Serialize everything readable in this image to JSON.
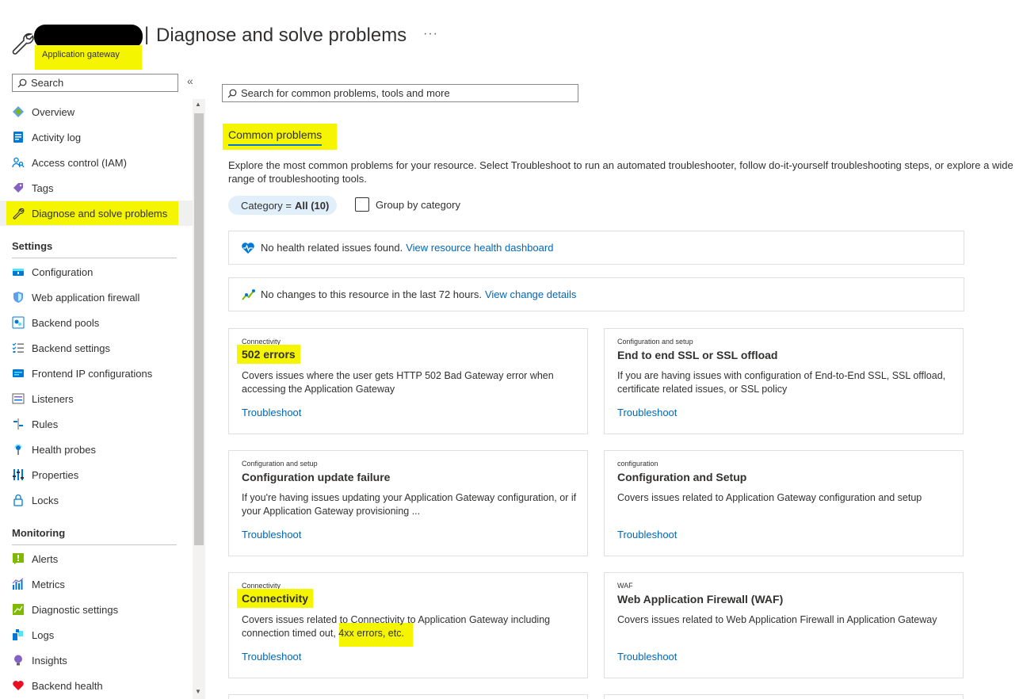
{
  "header": {
    "separator": "|",
    "title": "Diagnose and solve problems",
    "more": "···",
    "subtitle": "Application gateway"
  },
  "sidebar": {
    "search_placeholder": "Search",
    "collapse": "«",
    "items_top": [
      {
        "label": "Overview",
        "icon": "overview-icon"
      },
      {
        "label": "Activity log",
        "icon": "activity-log-icon"
      },
      {
        "label": "Access control (IAM)",
        "icon": "iam-icon"
      },
      {
        "label": "Tags",
        "icon": "tag-icon"
      },
      {
        "label": "Diagnose and solve problems",
        "icon": "wrench-icon",
        "active": true
      }
    ],
    "section_settings": "Settings",
    "items_settings": [
      {
        "label": "Configuration",
        "icon": "configuration-icon"
      },
      {
        "label": "Web application firewall",
        "icon": "shield-icon"
      },
      {
        "label": "Backend pools",
        "icon": "backend-pools-icon"
      },
      {
        "label": "Backend settings",
        "icon": "backend-settings-icon"
      },
      {
        "label": "Frontend IP configurations",
        "icon": "frontend-ip-icon"
      },
      {
        "label": "Listeners",
        "icon": "listeners-icon"
      },
      {
        "label": "Rules",
        "icon": "rules-icon"
      },
      {
        "label": "Health probes",
        "icon": "health-probe-icon"
      },
      {
        "label": "Properties",
        "icon": "properties-icon"
      },
      {
        "label": "Locks",
        "icon": "lock-icon"
      }
    ],
    "section_monitoring": "Monitoring",
    "items_monitoring": [
      {
        "label": "Alerts",
        "icon": "alerts-icon"
      },
      {
        "label": "Metrics",
        "icon": "metrics-icon"
      },
      {
        "label": "Diagnostic settings",
        "icon": "diagnostic-settings-icon"
      },
      {
        "label": "Logs",
        "icon": "logs-icon"
      },
      {
        "label": "Insights",
        "icon": "insights-icon"
      },
      {
        "label": "Backend health",
        "icon": "heart-icon"
      }
    ]
  },
  "main": {
    "search_placeholder": "Search for common problems, tools and more",
    "tab": "Common problems",
    "intro": "Explore the most common problems for your resource. Select Troubleshoot to run an automated troubleshooter, follow do-it-yourself troubleshooting steps, or explore a wide range of troubleshooting tools.",
    "filter": {
      "key": "Category",
      "op": "=",
      "value": "All (10)"
    },
    "group_by": "Group by category",
    "health_banner": {
      "text": "No health related issues found.",
      "link": "View resource health dashboard"
    },
    "changes_banner": {
      "text": "No changes to this resource in the last 72 hours.",
      "link": "View change details"
    },
    "troubleshoot": "Troubleshoot",
    "cards": [
      {
        "category": "Connectivity",
        "title": "502 errors",
        "desc": "Covers issues where the user gets HTTP 502 Bad Gateway error when accessing the Application Gateway"
      },
      {
        "category": "Configuration and setup",
        "title": "End to end SSL or SSL offload",
        "desc": "If you are having issues with configuration of End-to-End SSL, SSL offload, certificate related issues, or SSL policy"
      },
      {
        "category": "Configuration and setup",
        "title": "Configuration update failure",
        "desc": "If you're having issues updating your Application Gateway configuration, or if your Application Gateway provisioning ..."
      },
      {
        "category": "configuration",
        "title": "Configuration and Setup",
        "desc": "Covers issues related to Application Gateway configuration and setup"
      },
      {
        "category": "Connectivity",
        "title": "Connectivity",
        "desc": "Covers issues related to Connectivity to Application Gateway including connection timed out, 4xx errors, etc."
      },
      {
        "category": "WAF",
        "title": "Web Application Firewall (WAF)",
        "desc": "Covers issues related to Web Application Firewall in Application Gateway"
      }
    ]
  },
  "colors": {
    "highlight": "#f5f500",
    "link": "#0067b8",
    "accent": "#0078d4"
  }
}
